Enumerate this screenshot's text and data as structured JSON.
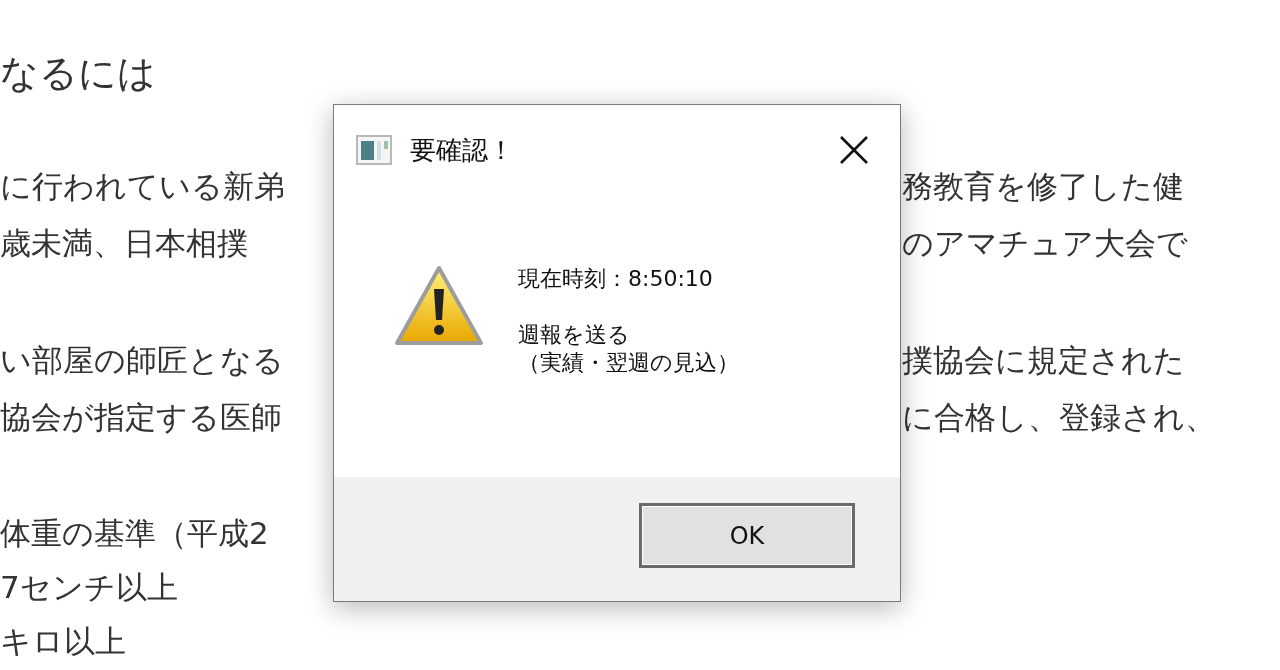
{
  "background": {
    "heading": "なるには",
    "paragraphs": [
      {
        "lines": [
          {
            "left": "に行われている新弟",
            "right": "務教育を修了した健"
          },
          {
            "left": "歳未満、日本相撲",
            "right": "のアマチュア大会で"
          }
        ]
      },
      {
        "lines": [
          {
            "left": "い部屋の師匠となる",
            "right": "撲協会に規定された"
          },
          {
            "left": "協会が指定する医師",
            "right": "に合格し、登録され、"
          }
        ]
      },
      {
        "lines": [
          {
            "left": "体重の基準（平成2"
          },
          {
            "left": "7センチ以上"
          },
          {
            "left": "キロ以上"
          }
        ]
      }
    ]
  },
  "dialog": {
    "title": "要確認！",
    "message": [
      {
        "lines": [
          "現在時刻：8:50:10"
        ]
      },
      {
        "lines": [
          "週報を送る",
          "（実績・翌週の見込）"
        ]
      }
    ],
    "buttons": [
      {
        "label": "OK",
        "default": true
      }
    ]
  }
}
